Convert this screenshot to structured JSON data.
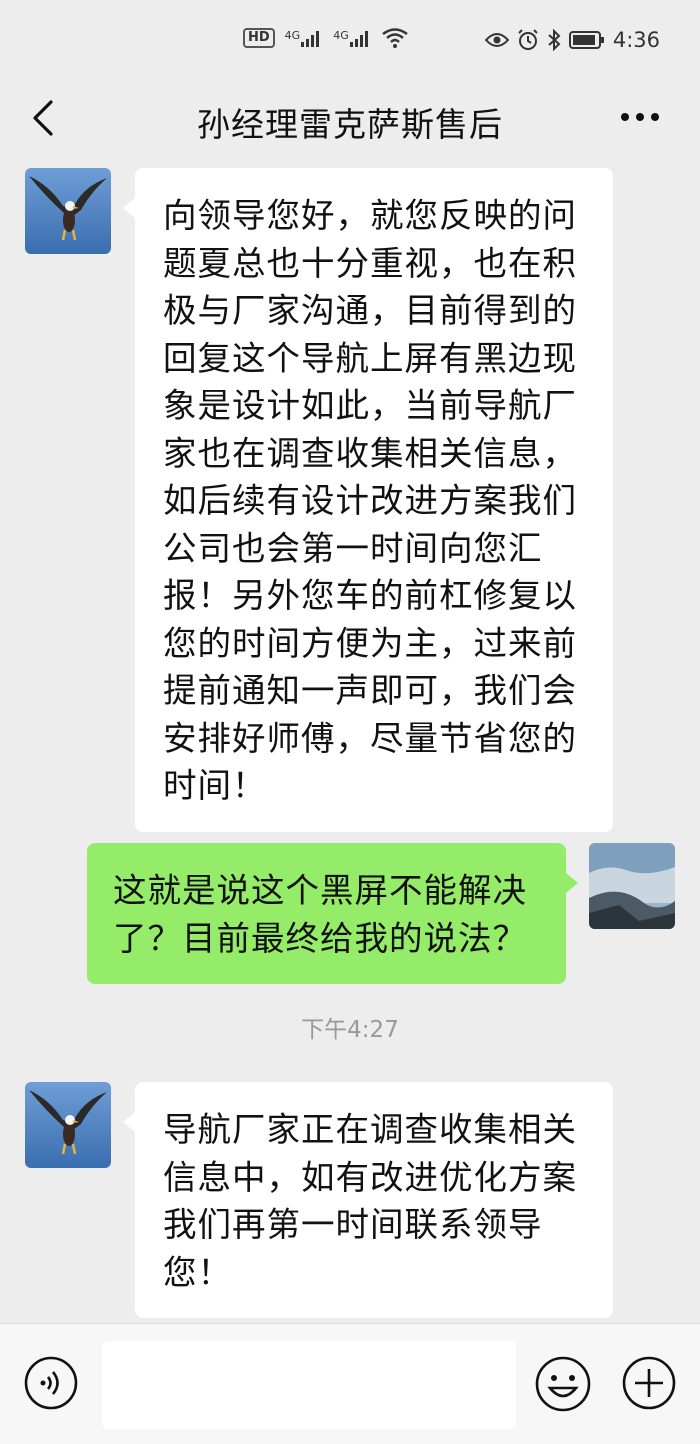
{
  "status": {
    "time": "4:36",
    "hd_label": "HD",
    "sim1_label": "4G",
    "sim2_label": "4G",
    "icons": [
      "wifi-icon",
      "eye-icon",
      "alarm-icon",
      "bluetooth-icon",
      "battery-icon"
    ]
  },
  "header": {
    "title": "孙经理雷克萨斯售后"
  },
  "messages": [
    {
      "side": "left",
      "lines": [
        "向领导您好，就您反映的问",
        "题夏总也十分重视，也在积",
        "极与厂家沟通，目前得到的",
        "回复这个导航上屏有黑边现",
        "象是设计如此，当前导航厂",
        "家也在调查收集相关信息，",
        "如后续有设计改进方案我们",
        "公司也会第一时间向您汇",
        "报！另外您车的前杠修复以",
        "您的时间方便为主，过来前",
        "提前通知一声即可，我们会",
        "安排好师傅，尽量节省您的",
        "时间！"
      ]
    },
    {
      "side": "right",
      "lines": [
        "这就是说这个黑屏不能解决",
        "了？目前最终给我的说法？"
      ]
    },
    {
      "side": "left",
      "lines": [
        "导航厂家正在调查收集相关",
        "信息中，如有改进优化方案",
        "我们再第一时间联系领导",
        "您！"
      ]
    }
  ],
  "timestamp": "下午4:27",
  "input": {
    "placeholder": ""
  },
  "colors": {
    "background": "#ededed",
    "bubble_self": "#95ec69",
    "bubble_other": "#ffffff"
  }
}
